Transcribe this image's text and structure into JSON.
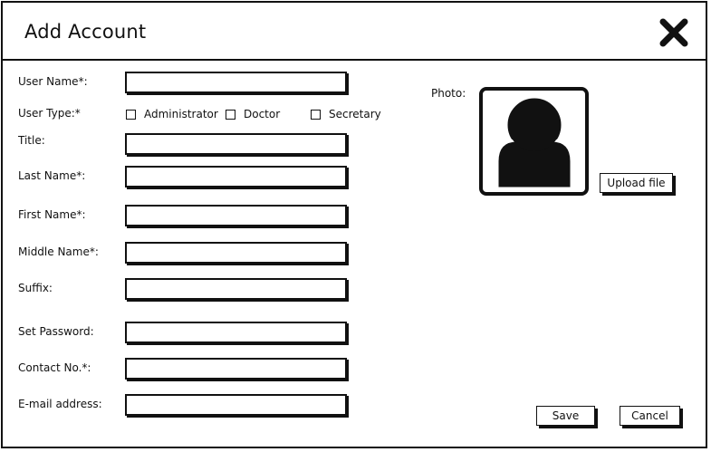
{
  "window": {
    "title": "Add Account"
  },
  "icons": {
    "close": "close-x-icon",
    "avatar": "user-avatar-icon"
  },
  "form": {
    "username": {
      "label": "User Name*:",
      "value": ""
    },
    "user_type": {
      "label": "User Type:*",
      "options": [
        {
          "label": "Administrator",
          "checked": false
        },
        {
          "label": "Doctor",
          "checked": false
        },
        {
          "label": "Secretary",
          "checked": false
        }
      ]
    },
    "title": {
      "label": "Title:",
      "value": ""
    },
    "last_name": {
      "label": "Last Name*:",
      "value": ""
    },
    "first_name": {
      "label": "First Name*:",
      "value": ""
    },
    "middle_name": {
      "label": "Middle Name*:",
      "value": ""
    },
    "suffix": {
      "label": "Suffix:",
      "value": ""
    },
    "password": {
      "label": "Set Password:",
      "value": ""
    },
    "contact": {
      "label": "Contact No.*:",
      "value": ""
    },
    "email": {
      "label": "E-mail address:",
      "value": ""
    }
  },
  "photo": {
    "label": "Photo:",
    "upload_label": "Upload file"
  },
  "actions": {
    "save_label": "Save",
    "cancel_label": "Cancel"
  }
}
